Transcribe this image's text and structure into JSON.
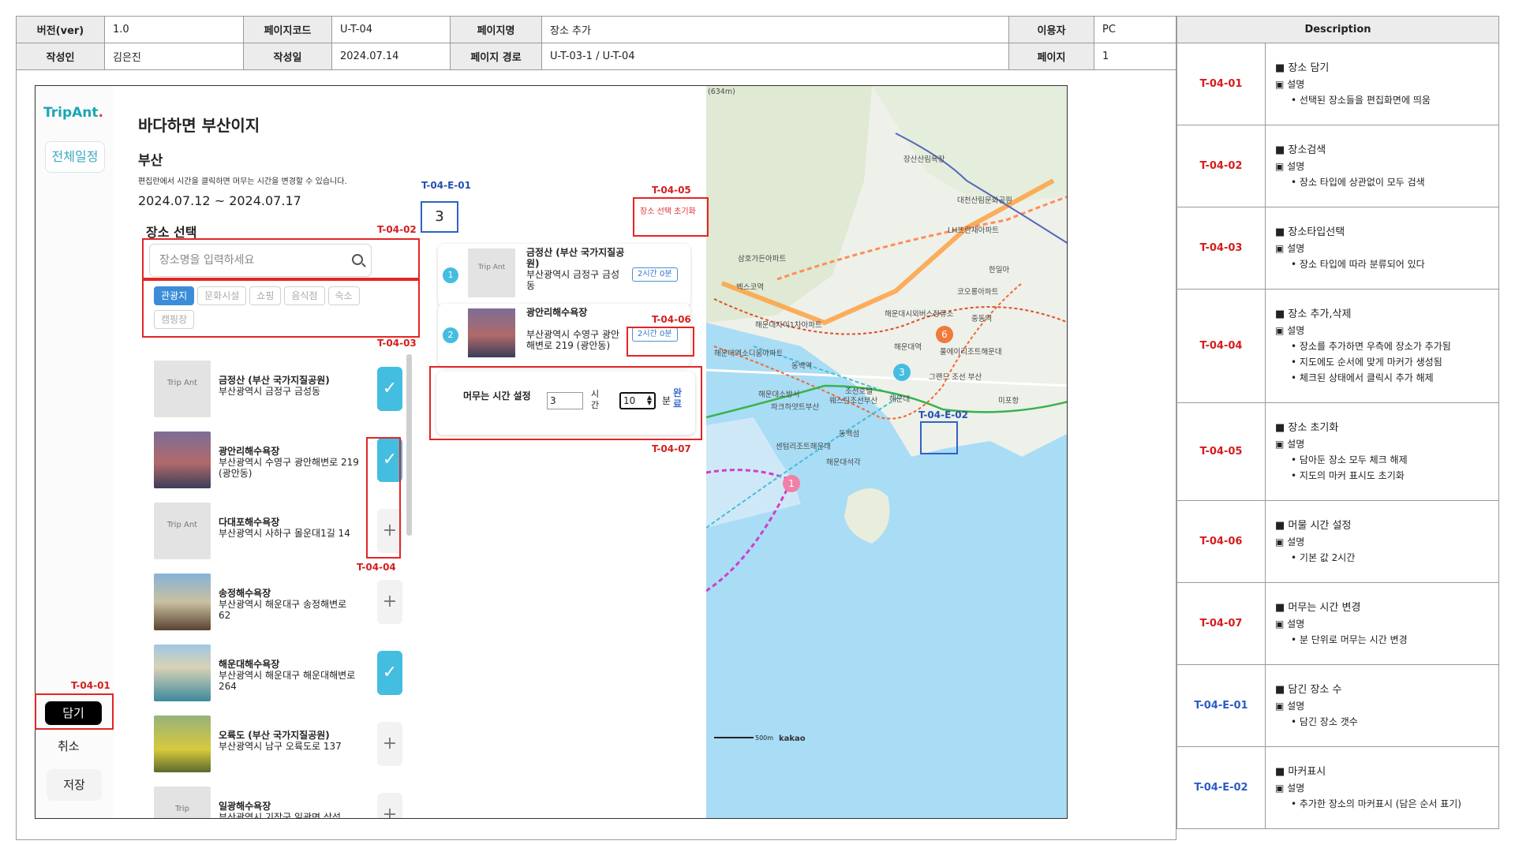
{
  "header": {
    "version_label": "버전(ver)",
    "version": "1.0",
    "pagecode_label": "페이지코드",
    "pagecode": "U-T-04",
    "pagename_label": "페이지명",
    "pagename": "장소 추가",
    "user_label": "이용자",
    "user": "PC",
    "author_label": "작성인",
    "author": "김은진",
    "date_label": "작성일",
    "date": "2024.07.14",
    "path_label": "페이지 경로",
    "path": "U-T-03-1 / U-T-04",
    "page_label": "페이지",
    "page": "1"
  },
  "app": {
    "logo_main": "TripAnt",
    "logo_dot": ".",
    "full_schedule": "전체일정",
    "trip_title": "바다하면 부산이지",
    "city": "부산",
    "note": "편집란에서 시간을 클릭하면 머무는 시간을 변경할 수 있습니다.",
    "dates": "2024.07.12 ~ 2024.07.17",
    "select_title": "장소 선택",
    "search_placeholder": "장소명을 입력하세요",
    "chips": [
      "관광지",
      "문화시설",
      "쇼핑",
      "음식점",
      "숙소",
      "캠핑장"
    ],
    "list": [
      {
        "name": "금정산 (부산 국가지질공원)",
        "addr": "부산광역시 금정구 금성동",
        "thumb": "Trip Ant",
        "checked": true
      },
      {
        "name": "광안리해수욕장",
        "addr": "부산광역시 수영구 광안해변로 219 (광안동)",
        "thumb": "",
        "checked": true
      },
      {
        "name": "다대포해수욕장",
        "addr": "부산광역시 사하구 몰운대1길 14",
        "thumb": "Trip Ant",
        "checked": false
      },
      {
        "name": "송정해수욕장",
        "addr": "부산광역시 해운대구 송정해변로 62",
        "thumb": "",
        "checked": false
      },
      {
        "name": "해운대해수욕장",
        "addr": "부산광역시 해운대구 해운대해변로 264",
        "thumb": "",
        "checked": true
      },
      {
        "name": "오륙도 (부산 국가지질공원)",
        "addr": "부산광역시 남구 오륙도로 137",
        "thumb": "",
        "checked": false
      },
      {
        "name": "일광해수욕장",
        "addr": "부산광역시 기장군 일광면 삼성",
        "thumb": "Trip",
        "checked": false
      }
    ],
    "count": "3",
    "reset": "장소 선택 초기화",
    "picked": [
      {
        "num": "1",
        "name": "금정산 (부산 국가지질공원)",
        "addr": "부산광역시 금정구 금성동",
        "thumb": "Trip Ant",
        "time": "2시간 0분"
      },
      {
        "num": "2",
        "name": "광안리해수욕장",
        "addr": "부산광역시 수영구 광안해변로 219 (광안동)",
        "thumb": "",
        "time": "2시간 0분"
      }
    ],
    "stay": {
      "label": "머무는 시간 설정",
      "hours": "3",
      "hours_unit": "시간",
      "minutes": "10",
      "minutes_unit": "분",
      "done": "완료"
    },
    "dam": "담기",
    "cancel": "취소",
    "save": "저장"
  },
  "map": {
    "labels": [
      "장산산림욕장",
      "대천산림문화공원",
      "LH뜨란채아파트",
      "한일아",
      "코오롱아파트",
      "중동역",
      "삼호가든아파트",
      "벡스코역",
      "해운대자이1차아파트",
      "해운대시외버스정류소",
      "해운대역",
      "해운대엑소디움아파트",
      "동백역",
      "그랜드 조선 부산",
      "풀에이리조트해운대",
      "조선호텔",
      "웨스틴조선부산",
      "해운대",
      "파크하얏트부산",
      "해운대소방서",
      "동백섬",
      "센텀리조트해운대",
      "해운대석각",
      "미포항",
      "(634m)"
    ],
    "scale": "500m",
    "brand": "kakao",
    "markers": [
      "1",
      "3",
      "6"
    ]
  },
  "annotations": {
    "t0401": "T-04-01",
    "t0402": "T-04-02",
    "t0403": "T-04-03",
    "t0404": "T-04-04",
    "t0405": "T-04-05",
    "t0406": "T-04-06",
    "t0407": "T-04-07",
    "te01": "T-04-E-01",
    "te02": "T-04-E-02"
  },
  "description": {
    "title": "Description",
    "rows": [
      {
        "code": "T-04-01",
        "head": "■ 장소 담기",
        "sub": "▣ 설명",
        "points": [
          "선택된 장소들을 편집화면에 띄움"
        ]
      },
      {
        "code": "T-04-02",
        "head": "■ 장소검색",
        "sub": "▣ 설명",
        "points": [
          "장소 타입에 상관없이 모두 검색"
        ]
      },
      {
        "code": "T-04-03",
        "head": "■ 장소타입선택",
        "sub": "▣ 설명",
        "points": [
          "장소 타입에 따라 분류되어 있다"
        ]
      },
      {
        "code": "T-04-04",
        "head": "■ 장소 추가,삭제",
        "sub": "▣ 설명",
        "points": [
          "장소를 추가하면 우측에 장소가 추가됨",
          "지도에도 순서에 맞게 마커가 생성됨",
          "체크된 상태에서 클릭시 추가 해제"
        ]
      },
      {
        "code": "T-04-05",
        "head": "■ 장소 초기화",
        "sub": "▣ 설명",
        "points": [
          "담아둔 장소 모두 체크 해제",
          "지도의 마커 표시도 초기화"
        ]
      },
      {
        "code": "T-04-06",
        "head": "■ 머물 시간 설정",
        "sub": "▣ 설명",
        "points": [
          "기본 값 2시간"
        ]
      },
      {
        "code": "T-04-07",
        "head": "■ 머무는 시간 변경",
        "sub": "▣ 설명",
        "points": [
          "분 단위로 머무는 시간 변경"
        ]
      },
      {
        "code": "T-04-E-01",
        "head": "■ 담긴 장소 수",
        "sub": "▣ 설명",
        "points": [
          "담긴 장소 갯수"
        ]
      },
      {
        "code": "T-04-E-02",
        "head": "■ 마커표시",
        "sub": "▣ 설명",
        "points": [
          "추가한 장소의 마커표시 (담은 순서 표기)"
        ]
      }
    ]
  },
  "colors": {
    "accent": "#43bde0",
    "annotation": "#e52424",
    "blue_annotation": "#2750b3"
  }
}
